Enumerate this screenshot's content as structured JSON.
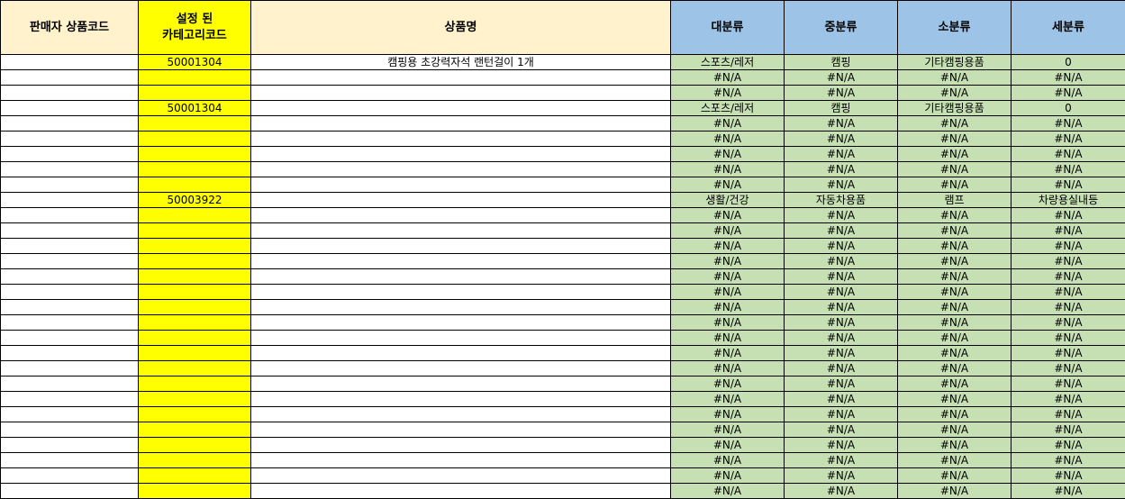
{
  "headers": {
    "seller_code": "판매자 상품코드",
    "set_category_code": "설정 된\n카테고리코드",
    "product_name": "상품명",
    "major": "대분류",
    "middle": "중분류",
    "minor": "소분류",
    "detail": "세분류"
  },
  "colors": {
    "header_cream": "#fff2cc",
    "header_yellow": "#ffff00",
    "header_blue": "#9dc3e6",
    "code_column": "#ffff00",
    "category_cells": "#c6e0b4"
  },
  "rows": [
    {
      "seller": "",
      "code": "50001304",
      "name": "캠핑용 초강력자석 랜턴걸이 1개",
      "major": "스포츠/레저",
      "middle": "캠핑",
      "minor": "기타캠핑용품",
      "detail": "0"
    },
    {
      "seller": "",
      "code": "",
      "name": "",
      "major": "#N/A",
      "middle": "#N/A",
      "minor": "#N/A",
      "detail": "#N/A"
    },
    {
      "seller": "",
      "code": "",
      "name": "",
      "major": "#N/A",
      "middle": "#N/A",
      "minor": "#N/A",
      "detail": "#N/A"
    },
    {
      "seller": "",
      "code": "50001304",
      "name": "",
      "major": "스포츠/레저",
      "middle": "캠핑",
      "minor": "기타캠핑용품",
      "detail": "0"
    },
    {
      "seller": "",
      "code": "",
      "name": "",
      "major": "#N/A",
      "middle": "#N/A",
      "minor": "#N/A",
      "detail": "#N/A"
    },
    {
      "seller": "",
      "code": "",
      "name": "",
      "major": "#N/A",
      "middle": "#N/A",
      "minor": "#N/A",
      "detail": "#N/A"
    },
    {
      "seller": "",
      "code": "",
      "name": "",
      "major": "#N/A",
      "middle": "#N/A",
      "minor": "#N/A",
      "detail": "#N/A"
    },
    {
      "seller": "",
      "code": "",
      "name": "",
      "major": "#N/A",
      "middle": "#N/A",
      "minor": "#N/A",
      "detail": "#N/A"
    },
    {
      "seller": "",
      "code": "",
      "name": "",
      "major": "#N/A",
      "middle": "#N/A",
      "minor": "#N/A",
      "detail": "#N/A"
    },
    {
      "seller": "",
      "code": "50003922",
      "name": "",
      "major": "생활/건강",
      "middle": "자동차용품",
      "minor": "램프",
      "detail": "차량용실내등"
    },
    {
      "seller": "",
      "code": "",
      "name": "",
      "major": "#N/A",
      "middle": "#N/A",
      "minor": "#N/A",
      "detail": "#N/A"
    },
    {
      "seller": "",
      "code": "",
      "name": "",
      "major": "#N/A",
      "middle": "#N/A",
      "minor": "#N/A",
      "detail": "#N/A"
    },
    {
      "seller": "",
      "code": "",
      "name": "",
      "major": "#N/A",
      "middle": "#N/A",
      "minor": "#N/A",
      "detail": "#N/A"
    },
    {
      "seller": "",
      "code": "",
      "name": "",
      "major": "#N/A",
      "middle": "#N/A",
      "minor": "#N/A",
      "detail": "#N/A"
    },
    {
      "seller": "",
      "code": "",
      "name": "",
      "major": "#N/A",
      "middle": "#N/A",
      "minor": "#N/A",
      "detail": "#N/A"
    },
    {
      "seller": "",
      "code": "",
      "name": "",
      "major": "#N/A",
      "middle": "#N/A",
      "minor": "#N/A",
      "detail": "#N/A"
    },
    {
      "seller": "",
      "code": "",
      "name": "",
      "major": "#N/A",
      "middle": "#N/A",
      "minor": "#N/A",
      "detail": "#N/A"
    },
    {
      "seller": "",
      "code": "",
      "name": "",
      "major": "#N/A",
      "middle": "#N/A",
      "minor": "#N/A",
      "detail": "#N/A"
    },
    {
      "seller": "",
      "code": "",
      "name": "",
      "major": "#N/A",
      "middle": "#N/A",
      "minor": "#N/A",
      "detail": "#N/A"
    },
    {
      "seller": "",
      "code": "",
      "name": "",
      "major": "#N/A",
      "middle": "#N/A",
      "minor": "#N/A",
      "detail": "#N/A"
    },
    {
      "seller": "",
      "code": "",
      "name": "",
      "major": "#N/A",
      "middle": "#N/A",
      "minor": "#N/A",
      "detail": "#N/A"
    },
    {
      "seller": "",
      "code": "",
      "name": "",
      "major": "#N/A",
      "middle": "#N/A",
      "minor": "#N/A",
      "detail": "#N/A"
    },
    {
      "seller": "",
      "code": "",
      "name": "",
      "major": "#N/A",
      "middle": "#N/A",
      "minor": "#N/A",
      "detail": "#N/A"
    },
    {
      "seller": "",
      "code": "",
      "name": "",
      "major": "#N/A",
      "middle": "#N/A",
      "minor": "#N/A",
      "detail": "#N/A"
    },
    {
      "seller": "",
      "code": "",
      "name": "",
      "major": "#N/A",
      "middle": "#N/A",
      "minor": "#N/A",
      "detail": "#N/A"
    },
    {
      "seller": "",
      "code": "",
      "name": "",
      "major": "#N/A",
      "middle": "#N/A",
      "minor": "#N/A",
      "detail": "#N/A"
    },
    {
      "seller": "",
      "code": "",
      "name": "",
      "major": "#N/A",
      "middle": "#N/A",
      "minor": "#N/A",
      "detail": "#N/A"
    },
    {
      "seller": "",
      "code": "",
      "name": "",
      "major": "#N/A",
      "middle": "#N/A",
      "minor": "#N/A",
      "detail": "#N/A"
    },
    {
      "seller": "",
      "code": "",
      "name": "",
      "major": "#N/A",
      "middle": "#N/A",
      "minor": "#N/A",
      "detail": "#N/A"
    }
  ]
}
